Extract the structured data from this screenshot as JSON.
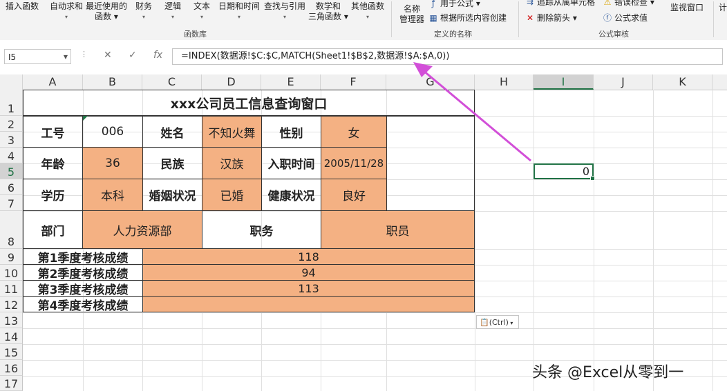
{
  "ribbon": {
    "buttons": [
      {
        "label": "插入函数",
        "sub": ""
      },
      {
        "label": "自动求和",
        "sub": "▾"
      },
      {
        "label": "最近使用的",
        "sub": "函数 ▾"
      },
      {
        "label": "财务",
        "sub": "▾"
      },
      {
        "label": "逻辑",
        "sub": "▾"
      },
      {
        "label": "文本",
        "sub": "▾"
      },
      {
        "label": "日期和时间",
        "sub": "▾"
      },
      {
        "label": "查找与引用",
        "sub": "▾"
      },
      {
        "label": "数学和",
        "sub": "三角函数 ▾"
      },
      {
        "label": "其他函数",
        "sub": "▾"
      }
    ],
    "group_function_library": "函数库",
    "name_manager": "名称",
    "name_manager_sub": "管理器",
    "use_in_formula": "用于公式 ▾",
    "create_from_selection": "根据所选内容创建",
    "group_defined_names": "定义的名称",
    "trace_dependents": "追踪从属单元格",
    "remove_arrows": "删除箭头 ▾",
    "error_checking": "错误检查 ▾",
    "evaluate_formula": "公式求值",
    "group_formula_auditing": "公式审核",
    "watch_window": "监视窗口",
    "calc_label": "计"
  },
  "formula_bar": {
    "name_box": "I5",
    "formula": "=INDEX(数据源!$C:$C,MATCH(Sheet1!$B$2,数据源!$A:$A,0))"
  },
  "columns": [
    "A",
    "B",
    "C",
    "D",
    "E",
    "F",
    "G",
    "H",
    "I",
    "J",
    "K"
  ],
  "rows": [
    "1",
    "2",
    "3",
    "4",
    "5",
    "6",
    "7",
    "8",
    "9",
    "10",
    "11",
    "12",
    "13",
    "14",
    "15",
    "16",
    "17"
  ],
  "form": {
    "title": "xxx公司员工信息查询窗口",
    "emp_id_label": "工号",
    "emp_id": "006",
    "name_label": "姓名",
    "name": "不知火舞",
    "gender_label": "性别",
    "gender": "女",
    "age_label": "年龄",
    "age": "36",
    "ethnic_label": "民族",
    "ethnic": "汉族",
    "hire_label": "入职时间",
    "hire": "2005/11/28",
    "edu_label": "学历",
    "edu": "本科",
    "marital_label": "婚姻状况",
    "marital": "已婚",
    "health_label": "健康状况",
    "health": "良好",
    "dept_label": "部门",
    "dept": "人力资源部",
    "position_label": "职务",
    "position": "职员",
    "q1_label": "第1季度考核成绩",
    "q1": "118",
    "q2_label": "第2季度考核成绩",
    "q2": "94",
    "q3_label": "第3季度考核成绩",
    "q3": "113",
    "q4_label": "第4季度考核成绩",
    "q4": ""
  },
  "selected_cell_value": "0",
  "paste_options": "(Ctrl)",
  "watermark": "头条 @Excel从零到一",
  "colors": {
    "accent": "#217346",
    "orange_fill": "#f4b183",
    "arrow": "#d24fd8"
  }
}
